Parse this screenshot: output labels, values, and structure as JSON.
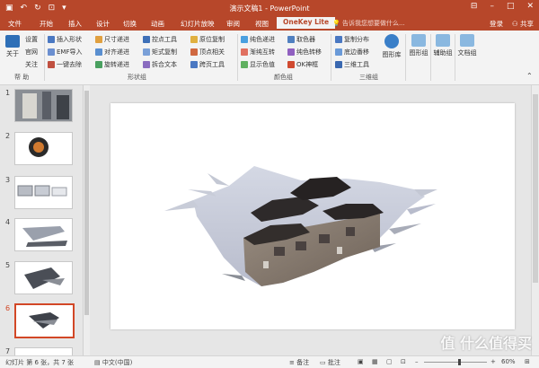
{
  "window": {
    "title": "演示文稿1 - PowerPoint",
    "qat": [
      "save-icon",
      "undo-icon",
      "redo-icon",
      "slideshow-icon",
      "customize-icon"
    ]
  },
  "tabs": [
    {
      "label": "文件"
    },
    {
      "label": "开始"
    },
    {
      "label": "插入"
    },
    {
      "label": "设计"
    },
    {
      "label": "切换"
    },
    {
      "label": "动画"
    },
    {
      "label": "幻灯片放映"
    },
    {
      "label": "审阅"
    },
    {
      "label": "视图"
    },
    {
      "label": "OneKey Lite"
    }
  ],
  "tell_me": "告诉我您想要做什么...",
  "login": "登录",
  "share": "共享",
  "ribbon": {
    "help_group": {
      "about": "关于",
      "settings": "设置",
      "website": "官网",
      "follow": "关注",
      "name": "帮 助"
    },
    "shape_group": {
      "col1": [
        "插入形状",
        "EMF导入",
        "一键去除"
      ],
      "col2": [
        "尺寸递进",
        "对齐递进",
        "旋转递进"
      ],
      "col3": [
        "控点工具",
        "矩式复制",
        "拆合文本"
      ],
      "col4": [
        "原位复制",
        "顶点相关",
        "跨页工具"
      ],
      "name": "形状组"
    },
    "color_group": {
      "col1": [
        "纯色递进",
        "渐纯互转",
        "显示色值"
      ],
      "col2": [
        "取色器",
        "纯色转移",
        "OK神框"
      ],
      "name": "颜色组"
    },
    "threed_group": {
      "col1": [
        "复制分布",
        "底边番移",
        "三维工具"
      ],
      "shape_lib": "图形库",
      "name": "三维组"
    },
    "extra_groups": [
      {
        "label": "图形组"
      },
      {
        "label": "辅助组"
      },
      {
        "label": "文档组"
      }
    ]
  },
  "slides": [
    {
      "num": "1"
    },
    {
      "num": "2"
    },
    {
      "num": "3"
    },
    {
      "num": "4"
    },
    {
      "num": "5"
    },
    {
      "num": "6"
    },
    {
      "num": "7"
    }
  ],
  "status": {
    "slide_info": "幻灯片 第 6 张，共 7 张",
    "language": "中文(中国)",
    "notes": "备注",
    "comments": "批注",
    "zoom": "60%"
  },
  "watermark": "值 什么值得买"
}
